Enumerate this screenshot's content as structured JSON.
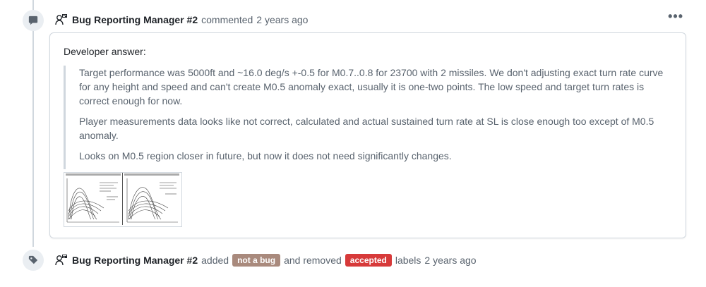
{
  "comment": {
    "author": "Bug Reporting Manager #2",
    "action": "commented",
    "time": "2 years ago",
    "menu_icon": "kebab-horizontal-icon",
    "intro": "Developer answer:",
    "quote": {
      "p1": "Target performance was 5000ft and ~16.0 deg/s +-0.5 for M0.7..0.8 for 23700 with 2 missiles. We don't adjusting exact turn rate curve for any height and speed and can't create M0.5 anomaly exact, usually it is one-two points. The low speed and target turn rates is correct enough for now.",
      "p2": "Player measurements data looks like not correct, calculated and actual sustained turn rate at SL is close enough too except of M0.5 anomaly.",
      "p3": "Looks on M0.5 region closer in future, but now it does not need significantly changes."
    }
  },
  "label_event": {
    "author": "Bug Reporting Manager #2",
    "added": "added",
    "label_added": "not a bug",
    "label_added_color": "#a98a7d",
    "removed": "and removed",
    "label_removed": "accepted",
    "label_removed_color": "#d73a3a",
    "suffix": "labels",
    "time": "2 years ago"
  },
  "colors": {
    "accent": "#1f2328",
    "muted": "#59636e",
    "border": "#d0d7de"
  }
}
